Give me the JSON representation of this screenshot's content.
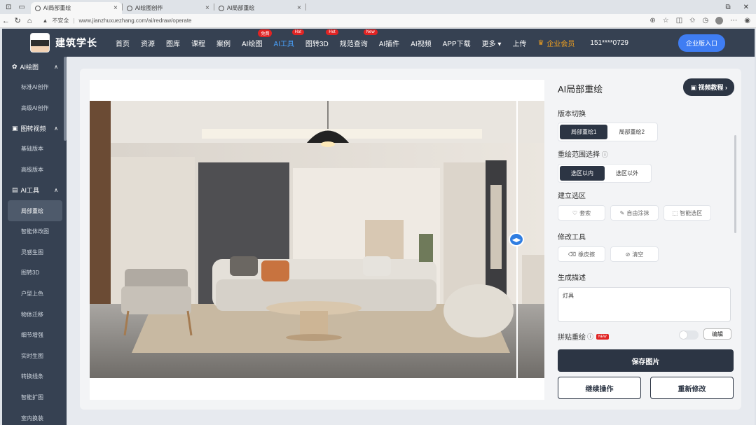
{
  "browser": {
    "tabs": [
      {
        "title": "AI局部重绘",
        "active": true
      },
      {
        "title": "AI绘图创作",
        "active": false
      },
      {
        "title": "AI局部重绘",
        "active": false
      }
    ],
    "security_label": "不安全",
    "url": "www.jianzhuxuezhang.com/ai/redraw/operate"
  },
  "header": {
    "brand": "建筑学长",
    "menu": [
      {
        "label": "首页"
      },
      {
        "label": "资源"
      },
      {
        "label": "图库"
      },
      {
        "label": "课程"
      },
      {
        "label": "案例"
      },
      {
        "label": "AI绘图",
        "badge": "免费"
      },
      {
        "label": "AI工具",
        "badge": "Hot",
        "active": true
      },
      {
        "label": "图转3D",
        "badge": "Hot"
      },
      {
        "label": "规范查询",
        "badge": "New"
      },
      {
        "label": "AI插件"
      },
      {
        "label": "AI视频"
      },
      {
        "label": "APP下载"
      },
      {
        "label": "更多 ▾"
      },
      {
        "label": "上传"
      }
    ],
    "vip_label": "企业会员",
    "phone": "151****0729",
    "enterprise_button": "企业版入口"
  },
  "sidebar": {
    "groups": [
      {
        "title": "AI绘图",
        "items": [
          "标准AI创作",
          "高级AI创作"
        ]
      },
      {
        "title": "图转视频",
        "items": [
          "基础版本",
          "高级版本"
        ]
      },
      {
        "title": "AI工具",
        "items": [
          "局部重绘",
          "智能体改图",
          "灵感生图",
          "图转3D",
          "户型上色",
          "物体迁移",
          "细节增强",
          "实时生图",
          "转换线条",
          "智能扩图",
          "室内换装"
        ]
      }
    ],
    "active_item": "局部重绘"
  },
  "panel": {
    "title": "AI局部重绘",
    "video_button": "视频教程",
    "version_label": "版本切换",
    "version_options": [
      "局部重绘1",
      "局部重绘2"
    ],
    "range_label": "重绘范围选择",
    "range_options": [
      "选区以内",
      "选区以外"
    ],
    "selection_label": "建立选区",
    "selection_tools": [
      "套索",
      "自由涂抹",
      "智能选区"
    ],
    "modify_label": "修改工具",
    "modify_tools": [
      "橡皮擦",
      "清空"
    ],
    "desc_label": "生成描述",
    "desc_value": "灯具",
    "collage_label": "拼贴重绘",
    "collage_badge": "NEW",
    "edit_button": "编辑",
    "save_button": "保存图片",
    "continue_button": "继续操作",
    "redo_button": "重新修改"
  }
}
